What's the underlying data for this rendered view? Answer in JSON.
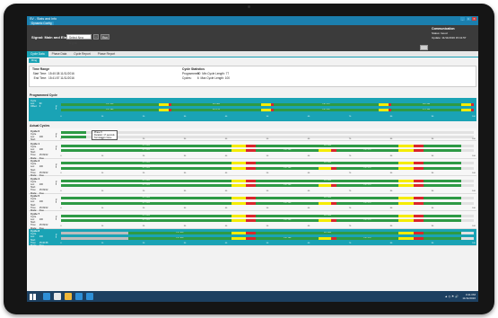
{
  "window": {
    "title": "SV - Stats and Info",
    "menu": "Dynamic Config",
    "controls": [
      "_",
      "□",
      "✕"
    ]
  },
  "header": {
    "signal_label": "Signal:",
    "signal_name": "Main and Elm",
    "signal_select": "Select New Signal",
    "browse_label": "...",
    "run_label": "Run",
    "communication": {
      "title": "Communication",
      "status_label": "Status:",
      "status_value": "Good",
      "update_label": "Update:",
      "update_value": "11/11/2016 15:41:57"
    }
  },
  "tabs": [
    {
      "label": "Cycle Data",
      "active": true
    },
    {
      "label": "Phase Data",
      "active": false
    },
    {
      "label": "Cycle Report",
      "active": false
    },
    {
      "label": "Phase Report",
      "active": false
    }
  ],
  "subtab": "Ring",
  "time_range": {
    "title": "Time Range",
    "start_label": "Start Time:",
    "start_value": "15:40:38 11/11/2016",
    "end_label": "End Time:",
    "end_value": "15:41:57 11/11/2016"
  },
  "cycle_stats": {
    "title": "Cycle Statistics",
    "programmed_label": "Programmed:",
    "programmed_value": "90",
    "min_label": "Min Cycle Length:",
    "min_value": "77",
    "cycles_label": "Cycles:",
    "cycles_value": "6",
    "max_label": "Max Cycle Length:",
    "max_value": "100"
  },
  "programmed": {
    "title": "Programmed Cycle",
    "length_label": "Cycle Len:",
    "length_value": "90",
    "offset_label": "Offset:",
    "offset_value": "0",
    "ring_label": "Ring"
  },
  "axis_ticks": [
    "0",
    "10",
    "20",
    "30",
    "40",
    "50",
    "60",
    "70",
    "80",
    "90",
    "100"
  ],
  "actual": {
    "title": "Actual Cycles",
    "field_labels": {
      "length": "Cycle Len:",
      "start": "Start Time:",
      "mode": "Mode:"
    },
    "tooltip": [
      "Phase 5",
      "Duration: 17 seconds",
      "Termination: None"
    ],
    "cycles": [
      {
        "name": "Cycle 0",
        "length": "100",
        "start": "15:40:38",
        "mode": "Free",
        "ring": "Ring"
      },
      {
        "name": "Cycle 1",
        "length": "100",
        "start": "15:39:02",
        "mode": "Free",
        "ring": "Ring"
      },
      {
        "name": "Cycle 3",
        "length": "100",
        "start": "15:39:02",
        "mode": "Free",
        "ring": "Ring"
      },
      {
        "name": "Cycle 4",
        "length": "100",
        "start": "15:39:02",
        "mode": "Free",
        "ring": "Ring"
      },
      {
        "name": "Cycle 5",
        "length": "100",
        "start": "15:39:02",
        "mode": "Free",
        "ring": "Ring"
      },
      {
        "name": "Cycle 7",
        "length": "100",
        "start": "15:39:02",
        "mode": "Free",
        "ring": "Ring"
      },
      {
        "name": "Cycle 8",
        "length": "100",
        "start": "15:40:38",
        "mode": "Free",
        "ring": "Ring",
        "selected": true
      }
    ]
  },
  "rings": {
    "programmed": [
      [
        {
          "c": "green",
          "s": 0,
          "e": 39,
          "t": "P2 / 22s"
        },
        {
          "c": "yellow",
          "s": 39,
          "e": 43
        },
        {
          "c": "red",
          "s": 43,
          "e": 44
        },
        {
          "c": "green",
          "s": 44,
          "e": 80,
          "t": "P4 / 30s"
        },
        {
          "c": "yellow",
          "s": 80,
          "e": 84
        },
        {
          "c": "red",
          "s": 84,
          "e": 85
        },
        {
          "c": "green",
          "s": 85,
          "e": 127,
          "t": "P6 / 27s"
        },
        {
          "c": "yellow",
          "s": 127,
          "e": 131
        },
        {
          "c": "red",
          "s": 131,
          "e": 132
        },
        {
          "c": "green",
          "s": 132,
          "e": 160,
          "t": "P8 / 26s"
        },
        {
          "c": "yellow",
          "s": 160,
          "e": 164
        },
        {
          "c": "red",
          "s": 164,
          "e": 165
        }
      ],
      [
        {
          "c": "green",
          "s": 0,
          "e": 39,
          "t": "P1 / 14s"
        },
        {
          "c": "yellow",
          "s": 39,
          "e": 43
        },
        {
          "c": "red",
          "s": 43,
          "e": 44
        },
        {
          "c": "green",
          "s": 44,
          "e": 80,
          "t": "P3 / 17s"
        },
        {
          "c": "yellow",
          "s": 80,
          "e": 84
        },
        {
          "c": "red",
          "s": 84,
          "e": 85
        },
        {
          "c": "green",
          "s": 85,
          "e": 127,
          "t": "P5 / 22s"
        },
        {
          "c": "yellow",
          "s": 127,
          "e": 131
        },
        {
          "c": "red",
          "s": 131,
          "e": 132
        },
        {
          "c": "green",
          "s": 132,
          "e": 160,
          "t": "P7 / 15s"
        },
        {
          "c": "yellow",
          "s": 160,
          "e": 164
        },
        {
          "c": "red",
          "s": 164,
          "e": 165
        }
      ]
    ],
    "cycle0": [
      [
        {
          "c": "green",
          "s": 0,
          "e": 10
        }
      ],
      [
        {
          "c": "green",
          "s": 0,
          "e": 10
        }
      ]
    ],
    "cycle": [
      [
        {
          "c": "green",
          "s": 0,
          "e": 68,
          "t": "P2 / 42s"
        },
        {
          "c": "yellow",
          "s": 68,
          "e": 74
        },
        {
          "c": "red",
          "s": 74,
          "e": 78
        },
        {
          "c": "green",
          "s": 78,
          "e": 135,
          "t": "P6 / 46s"
        },
        {
          "c": "yellow",
          "s": 135,
          "e": 141
        },
        {
          "c": "red",
          "s": 141,
          "e": 145
        },
        {
          "c": "green",
          "s": 145,
          "e": 160
        }
      ],
      [
        {
          "c": "green",
          "s": 0,
          "e": 68,
          "t": "P1 / 42s"
        },
        {
          "c": "yellow",
          "s": 68,
          "e": 74
        },
        {
          "c": "red",
          "s": 74,
          "e": 78
        },
        {
          "c": "green",
          "s": 78,
          "e": 103,
          "t": "P3 / 16s"
        },
        {
          "c": "yellow",
          "s": 103,
          "e": 108
        },
        {
          "c": "red",
          "s": 108,
          "e": 110
        },
        {
          "c": "green",
          "s": 110,
          "e": 135,
          "t": "P5 / 17s"
        },
        {
          "c": "yellow",
          "s": 135,
          "e": 141
        },
        {
          "c": "red",
          "s": 141,
          "e": 145
        },
        {
          "c": "green",
          "s": 145,
          "e": 160
        }
      ]
    ],
    "cycle_last": [
      [
        {
          "c": "grey",
          "s": 0,
          "e": 27
        },
        {
          "c": "green",
          "s": 27,
          "e": 68,
          "t": "P2 / 42s"
        },
        {
          "c": "yellow",
          "s": 68,
          "e": 74
        },
        {
          "c": "red",
          "s": 74,
          "e": 78
        },
        {
          "c": "green",
          "s": 78,
          "e": 135,
          "t": "P6 / 46s"
        },
        {
          "c": "yellow",
          "s": 135,
          "e": 141
        },
        {
          "c": "red",
          "s": 141,
          "e": 145
        },
        {
          "c": "green",
          "s": 145,
          "e": 160
        }
      ],
      [
        {
          "c": "grey",
          "s": 0,
          "e": 27
        },
        {
          "c": "green",
          "s": 27,
          "e": 68,
          "t": "P1 / 42s"
        },
        {
          "c": "yellow",
          "s": 68,
          "e": 74
        },
        {
          "c": "red",
          "s": 74,
          "e": 78
        },
        {
          "c": "green",
          "s": 78,
          "e": 103,
          "t": "P3 / 16s"
        },
        {
          "c": "yellow",
          "s": 103,
          "e": 108
        },
        {
          "c": "red",
          "s": 108,
          "e": 110
        },
        {
          "c": "green",
          "s": 110,
          "e": 135,
          "t": "P5 / 17s"
        },
        {
          "c": "yellow",
          "s": 135,
          "e": 141
        },
        {
          "c": "red",
          "s": 141,
          "e": 145
        },
        {
          "c": "green",
          "s": 145,
          "e": 160
        }
      ]
    ]
  },
  "taskbar": {
    "time": "3:41 PM",
    "date": "11/11/2016",
    "tray": "▲ ◷ ⚑ 🔊",
    "apps": [
      "#2f8fd6",
      "#e8e8e8",
      "#f0b83a",
      "#2f8fd6",
      "#2f8fd6"
    ]
  },
  "colors": {
    "accent": "#1aa3b5",
    "green": "#2e9a45",
    "yellow": "#f5ec00",
    "red": "#d9262b"
  }
}
